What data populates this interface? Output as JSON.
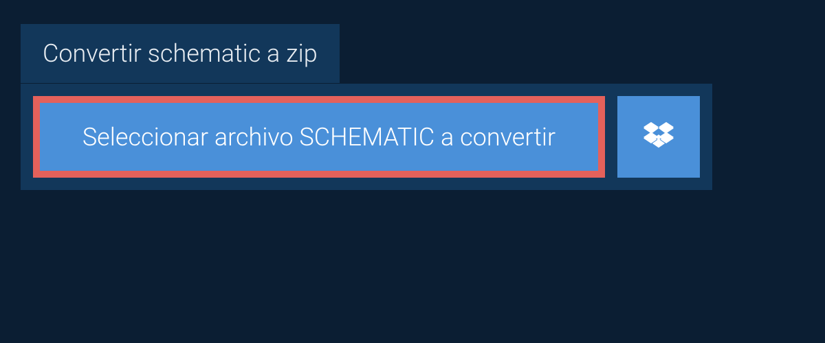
{
  "tab": {
    "title": "Convertir schematic a zip"
  },
  "panel": {
    "select_label": "Seleccionar archivo SCHEMATIC a convertir"
  },
  "colors": {
    "background": "#0b1e33",
    "panel": "#12375a",
    "button": "#4a90d9",
    "highlight_border": "#e4615b",
    "text": "#e8edf2"
  }
}
